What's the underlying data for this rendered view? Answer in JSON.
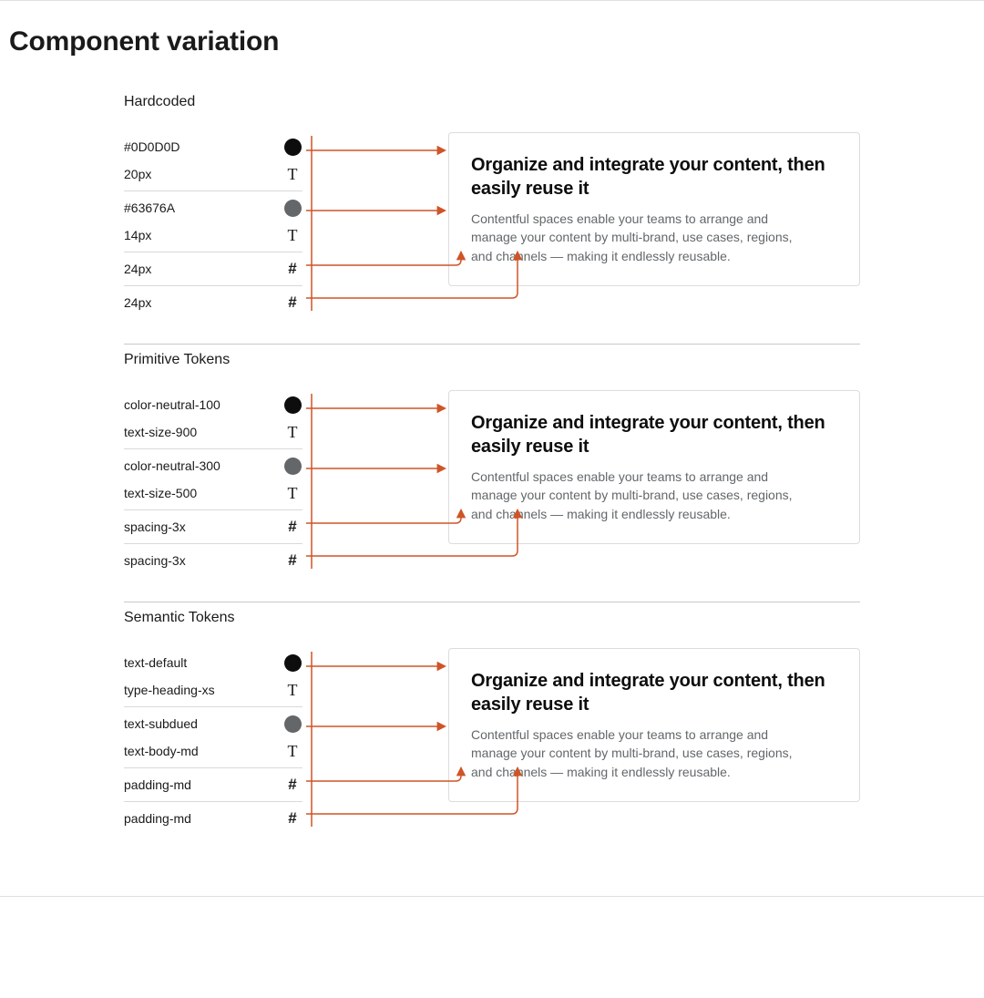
{
  "title": "Component variation",
  "arrow_color": "#cf5426",
  "card": {
    "heading": "Organize and integrate your content, then easily reuse it",
    "body": "Contentful spaces enable your teams to arrange and manage your content by multi-brand, use cases, regions, and channels — making it endlessly reusable."
  },
  "sections": [
    {
      "title": "Hardcoded",
      "groups": [
        {
          "lines": [
            {
              "label": "#0D0D0D",
              "icon": "dot-black"
            },
            {
              "label": "20px",
              "icon": "T"
            }
          ]
        },
        {
          "lines": [
            {
              "label": "#63676A",
              "icon": "dot-gray"
            },
            {
              "label": "14px",
              "icon": "T"
            }
          ]
        },
        {
          "lines": [
            {
              "label": "24px",
              "icon": "hash"
            }
          ]
        },
        {
          "lines": [
            {
              "label": "24px",
              "icon": "hash"
            }
          ]
        }
      ]
    },
    {
      "title": "Primitive Tokens",
      "groups": [
        {
          "lines": [
            {
              "label": "color-neutral-100",
              "icon": "dot-black"
            },
            {
              "label": "text-size-900",
              "icon": "T"
            }
          ]
        },
        {
          "lines": [
            {
              "label": "color-neutral-300",
              "icon": "dot-gray"
            },
            {
              "label": "text-size-500",
              "icon": "T"
            }
          ]
        },
        {
          "lines": [
            {
              "label": "spacing-3x",
              "icon": "hash"
            }
          ]
        },
        {
          "lines": [
            {
              "label": "spacing-3x",
              "icon": "hash"
            }
          ]
        }
      ]
    },
    {
      "title": "Semantic Tokens",
      "groups": [
        {
          "lines": [
            {
              "label": "text-default",
              "icon": "dot-black"
            },
            {
              "label": "type-heading-xs",
              "icon": "T"
            }
          ]
        },
        {
          "lines": [
            {
              "label": "text-subdued",
              "icon": "dot-gray"
            },
            {
              "label": "text-body-md",
              "icon": "T"
            }
          ]
        },
        {
          "lines": [
            {
              "label": "padding-md",
              "icon": "hash"
            }
          ]
        },
        {
          "lines": [
            {
              "label": "padding-md",
              "icon": "hash"
            }
          ]
        }
      ]
    }
  ]
}
